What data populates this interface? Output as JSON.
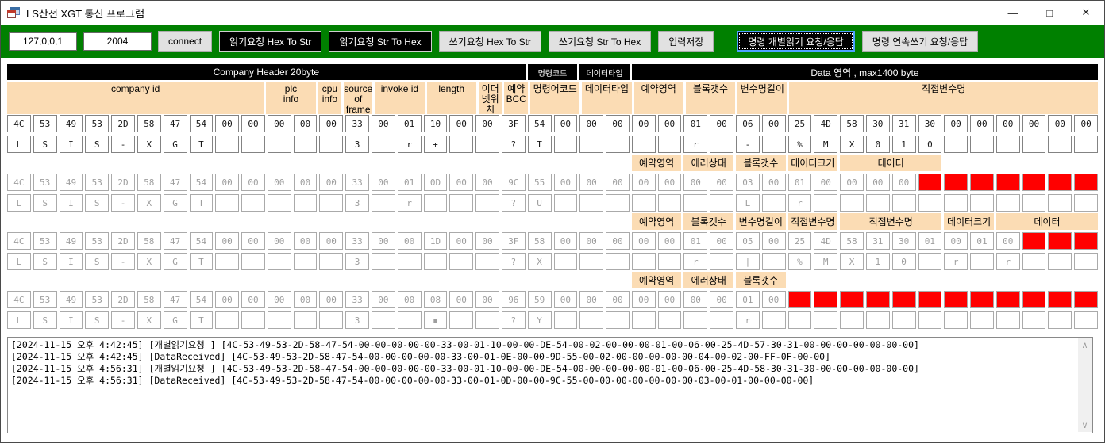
{
  "window": {
    "title": "LS산전 XGT 통신 프로그램",
    "controls": {
      "minimize": "—",
      "maximize": "□",
      "close": "✕"
    }
  },
  "toolbar": {
    "ip_value": "127,0,0,1",
    "port_value": "2004",
    "buttons": [
      {
        "label": "connect",
        "style": "gray"
      },
      {
        "label": "읽기요청 Hex To Str",
        "style": "black"
      },
      {
        "label": "읽기요청 Str To Hex",
        "style": "black"
      },
      {
        "label": "쓰기요청 Hex To Str",
        "style": "gray"
      },
      {
        "label": "쓰기요청 Str To Hex",
        "style": "gray"
      },
      {
        "label": "입력저장",
        "style": "gray"
      },
      {
        "label": "명령 개별읽기 요청/응답",
        "style": "black",
        "focused": true
      },
      {
        "label": "명령 연속쓰기 요청/응답",
        "style": "gray"
      }
    ]
  },
  "grid": {
    "columns": 42,
    "section_bars": [
      {
        "label": "Company Header 20byte",
        "start": 1,
        "span": 20,
        "small": false
      },
      {
        "label": "명령코드",
        "start": 21,
        "span": 2,
        "small": true
      },
      {
        "label": "데이터타입",
        "start": 23,
        "span": 2,
        "small": true
      },
      {
        "label": "Data 영역 , max1400 byte",
        "start": 25,
        "span": 18,
        "small": false
      }
    ],
    "column_headers": [
      {
        "label": "company id",
        "start": 1,
        "span": 10
      },
      {
        "label": "plc\ninfo",
        "start": 11,
        "span": 2
      },
      {
        "label": "cpu\ninfo",
        "start": 13,
        "span": 1
      },
      {
        "label": "source\nof\nframe",
        "start": 14,
        "span": 1
      },
      {
        "label": "invoke id",
        "start": 15,
        "span": 2
      },
      {
        "label": "length",
        "start": 17,
        "span": 2
      },
      {
        "label": "이더\n넷위\n치",
        "start": 19,
        "span": 1
      },
      {
        "label": "예약\nBCC",
        "start": 20,
        "span": 1
      },
      {
        "label": "명령어코드",
        "start": 21,
        "span": 2
      },
      {
        "label": "데이터타입",
        "start": 23,
        "span": 2
      },
      {
        "label": "예약영역",
        "start": 25,
        "span": 2
      },
      {
        "label": "블록갯수",
        "start": 27,
        "span": 2
      },
      {
        "label": "변수명길이",
        "start": 29,
        "span": 2
      },
      {
        "label": "직접변수명",
        "start": 31,
        "span": 12
      }
    ],
    "byte_rows": [
      {
        "name": "request-individual-read",
        "tone": "dark",
        "hex": [
          "4C",
          "53",
          "49",
          "53",
          "2D",
          "58",
          "47",
          "54",
          "00",
          "00",
          "00",
          "00",
          "00",
          "33",
          "00",
          "01",
          "10",
          "00",
          "00",
          "3F",
          "54",
          "00",
          "00",
          "00",
          "00",
          "00",
          "01",
          "00",
          "06",
          "00",
          "25",
          "4D",
          "58",
          "30",
          "31",
          "30",
          "00",
          "00",
          "00",
          "00",
          "00",
          "00"
        ],
        "chars": [
          "L",
          "S",
          "I",
          "S",
          "-",
          "X",
          "G",
          "T",
          "",
          "",
          "",
          "",
          "",
          "3",
          "",
          "r",
          "+",
          "",
          "",
          "?",
          "T",
          "",
          "",
          "",
          "",
          "",
          "r",
          "",
          "-",
          "",
          "%",
          "M",
          "X",
          "0",
          "1",
          "0",
          "",
          "",
          "",
          "",
          "",
          ""
        ],
        "red_from": 42
      },
      {
        "name": "response-individual-read",
        "tone": "gray",
        "hex": [
          "4C",
          "53",
          "49",
          "53",
          "2D",
          "58",
          "47",
          "54",
          "00",
          "00",
          "00",
          "00",
          "00",
          "33",
          "00",
          "01",
          "0D",
          "00",
          "00",
          "9C",
          "55",
          "00",
          "00",
          "00",
          "00",
          "00",
          "00",
          "00",
          "03",
          "00",
          "01",
          "00",
          "00",
          "00",
          "00"
        ],
        "chars": [
          "L",
          "S",
          "I",
          "S",
          "-",
          "X",
          "G",
          "T",
          "",
          "",
          "",
          "",
          "",
          "3",
          "",
          "r",
          "",
          "",
          "",
          "?",
          "U",
          "",
          "",
          "",
          "",
          "",
          "",
          "",
          "L",
          "",
          "r",
          "",
          "",
          "",
          ""
        ],
        "red_from": 35
      },
      {
        "name": "request-continuous-write",
        "tone": "gray",
        "hex": [
          "4C",
          "53",
          "49",
          "53",
          "2D",
          "58",
          "47",
          "54",
          "00",
          "00",
          "00",
          "00",
          "00",
          "33",
          "00",
          "00",
          "1D",
          "00",
          "00",
          "3F",
          "58",
          "00",
          "00",
          "00",
          "00",
          "00",
          "01",
          "00",
          "05",
          "00",
          "25",
          "4D",
          "58",
          "31",
          "30",
          "01",
          "00",
          "01",
          "00"
        ],
        "chars": [
          "L",
          "S",
          "I",
          "S",
          "-",
          "X",
          "G",
          "T",
          "",
          "",
          "",
          "",
          "",
          "3",
          "",
          "",
          "",
          "",
          "",
          "?",
          "X",
          "",
          "",
          "",
          "",
          "",
          "r",
          "",
          "|",
          "",
          "%",
          "M",
          "X",
          "1",
          "0",
          "",
          "r",
          "",
          "r"
        ],
        "red_from": 39
      },
      {
        "name": "response-continuous-write",
        "tone": "gray",
        "hex": [
          "4C",
          "53",
          "49",
          "53",
          "2D",
          "58",
          "47",
          "54",
          "00",
          "00",
          "00",
          "00",
          "00",
          "33",
          "00",
          "00",
          "08",
          "00",
          "00",
          "96",
          "59",
          "00",
          "00",
          "00",
          "00",
          "00",
          "00",
          "00",
          "01",
          "00"
        ],
        "chars": [
          "L",
          "S",
          "I",
          "S",
          "-",
          "X",
          "G",
          "T",
          "",
          "",
          "",
          "",
          "",
          "3",
          "",
          "",
          "▪",
          "",
          "",
          "?",
          "Y",
          "",
          "",
          "",
          "",
          "",
          "",
          "",
          "r",
          ""
        ],
        "red_from": 30
      }
    ],
    "label_bands": [
      {
        "after_row": 0,
        "items": [
          {
            "label": "예약영역",
            "start": 25,
            "span": 2
          },
          {
            "label": "에러상태",
            "start": 27,
            "span": 2
          },
          {
            "label": "블록갯수",
            "start": 29,
            "span": 2
          },
          {
            "label": "데이터크기",
            "start": 31,
            "span": 2
          },
          {
            "label": "데이터",
            "start": 33,
            "span": 4
          }
        ]
      },
      {
        "after_row": 1,
        "items": [
          {
            "label": "예약영역",
            "start": 25,
            "span": 2
          },
          {
            "label": "블록갯수",
            "start": 27,
            "span": 2
          },
          {
            "label": "변수명길이",
            "start": 29,
            "span": 2
          },
          {
            "label": "직접변수명",
            "start": 31,
            "span": 2
          },
          {
            "label": "직접변수명",
            "start": 33,
            "span": 4
          },
          {
            "label": "데이터크기",
            "start": 37,
            "span": 2
          },
          {
            "label": "데이터",
            "start": 39,
            "span": 4
          }
        ]
      },
      {
        "after_row": 2,
        "items": [
          {
            "label": "예약영역",
            "start": 25,
            "span": 2
          },
          {
            "label": "에러상태",
            "start": 27,
            "span": 2
          },
          {
            "label": "블록갯수",
            "start": 29,
            "span": 2
          }
        ]
      }
    ]
  },
  "log": {
    "lines": [
      "[2024-11-15 오후 4:42:45] [개별읽기요청 ] [4C-53-49-53-2D-58-47-54-00-00-00-00-00-33-00-01-10-00-00-DE-54-00-02-00-00-00-01-00-06-00-25-4D-57-30-31-00-00-00-00-00-00-00]",
      "[2024-11-15 오후 4:42:45] [DataReceived] [4C-53-49-53-2D-58-47-54-00-00-00-00-00-33-00-01-0E-00-00-9D-55-00-02-00-00-00-00-00-04-00-02-00-FF-0F-00-00]",
      "[2024-11-15 오후 4:56:31] [개별읽기요청 ] [4C-53-49-53-2D-58-47-54-00-00-00-00-00-33-00-01-10-00-00-DE-54-00-00-00-00-00-01-00-06-00-25-4D-58-30-31-30-00-00-00-00-00-00]",
      "[2024-11-15 오후 4:56:31] [DataReceived] [4C-53-49-53-2D-58-47-54-00-00-00-00-00-33-00-01-0D-00-00-9C-55-00-00-00-00-00-00-00-03-00-01-00-00-00-00]"
    ],
    "scroll_up_glyph": "∧",
    "scroll_down_glyph": "∨"
  },
  "colors": {
    "toolbar_green": "#008000",
    "header_peach": "#fbdcb4",
    "bar_black": "#000000",
    "cell_red": "#ff0000",
    "gray_row_text": "#9e9e9e",
    "focus_blue": "#4da2ff"
  }
}
